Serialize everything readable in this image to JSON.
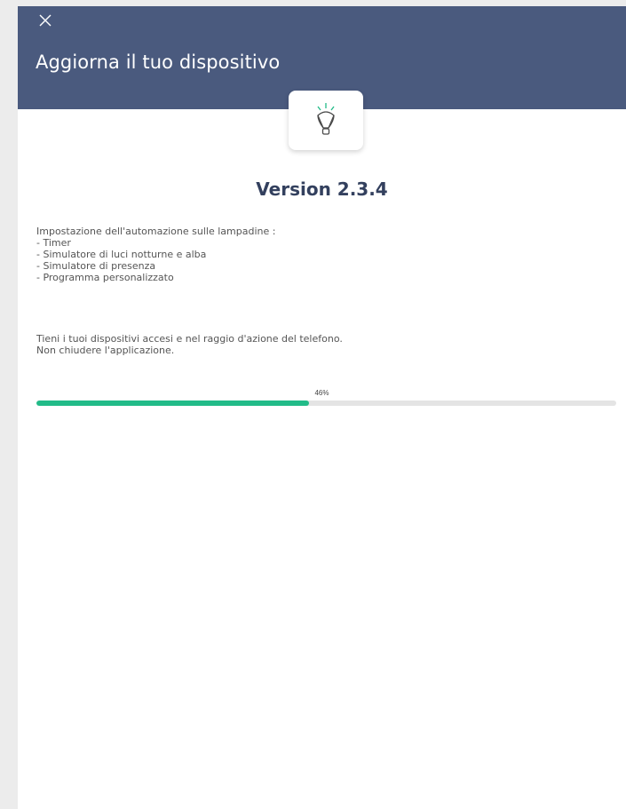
{
  "header": {
    "title": "Aggiorna il tuo dispositivo",
    "close_icon": "close-icon",
    "background": "#4a5a7e"
  },
  "device_icon": "lightbulb-icon",
  "version": {
    "title": "Version 2.3.4"
  },
  "release_notes": [
    "Impostazione dell'automazione sulle lampadine :",
    "- Timer",
    "- Simulatore di luci notturne e alba",
    "- Simulatore di presenza",
    "- Programma personalizzato"
  ],
  "info": [
    "Tieni i tuoi dispositivi accesi e nel raggio d'azione del telefono.",
    "Non chiudere l'applicazione."
  ],
  "progress": {
    "label": "46%",
    "value": 0.47,
    "color": "#22bb88"
  }
}
